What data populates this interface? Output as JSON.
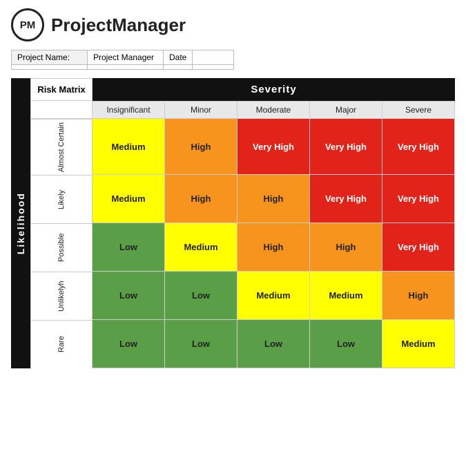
{
  "header": {
    "logo_text": "PM",
    "app_title": "ProjectManager"
  },
  "project_info": {
    "project_name_label": "Project Name:",
    "project_name_value": "",
    "project_manager_label": "Project Manager",
    "project_manager_value": "",
    "date_label": "Date",
    "date_value": ""
  },
  "matrix": {
    "likelihood_label": "Likelihood",
    "severity_label": "Severity",
    "risk_matrix_label": "Risk Matrix",
    "col_headers": [
      "Insignificant",
      "Minor",
      "Moderate",
      "Major",
      "Severe"
    ],
    "rows": [
      {
        "label": "Almost Certain",
        "cells": [
          {
            "text": "Medium",
            "style": "cell-medium"
          },
          {
            "text": "High",
            "style": "cell-high"
          },
          {
            "text": "Very High",
            "style": "cell-very-high"
          },
          {
            "text": "Very High",
            "style": "cell-very-high"
          },
          {
            "text": "Very High",
            "style": "cell-very-high"
          }
        ]
      },
      {
        "label": "Likely",
        "cells": [
          {
            "text": "Medium",
            "style": "cell-medium"
          },
          {
            "text": "High",
            "style": "cell-high"
          },
          {
            "text": "High",
            "style": "cell-high"
          },
          {
            "text": "Very High",
            "style": "cell-very-high"
          },
          {
            "text": "Very High",
            "style": "cell-very-high"
          }
        ]
      },
      {
        "label": "Possible",
        "cells": [
          {
            "text": "Low",
            "style": "cell-low"
          },
          {
            "text": "Medium",
            "style": "cell-medium"
          },
          {
            "text": "High",
            "style": "cell-high"
          },
          {
            "text": "High",
            "style": "cell-high"
          },
          {
            "text": "Very High",
            "style": "cell-very-high"
          }
        ]
      },
      {
        "label": "Unlikelyh",
        "cells": [
          {
            "text": "Low",
            "style": "cell-low"
          },
          {
            "text": "Low",
            "style": "cell-low"
          },
          {
            "text": "Medium",
            "style": "cell-medium"
          },
          {
            "text": "Medium",
            "style": "cell-medium"
          },
          {
            "text": "High",
            "style": "cell-high"
          }
        ]
      },
      {
        "label": "Rare",
        "cells": [
          {
            "text": "Low",
            "style": "cell-low"
          },
          {
            "text": "Low",
            "style": "cell-low"
          },
          {
            "text": "Low",
            "style": "cell-low"
          },
          {
            "text": "Low",
            "style": "cell-low"
          },
          {
            "text": "Medium",
            "style": "cell-medium"
          }
        ]
      }
    ]
  }
}
